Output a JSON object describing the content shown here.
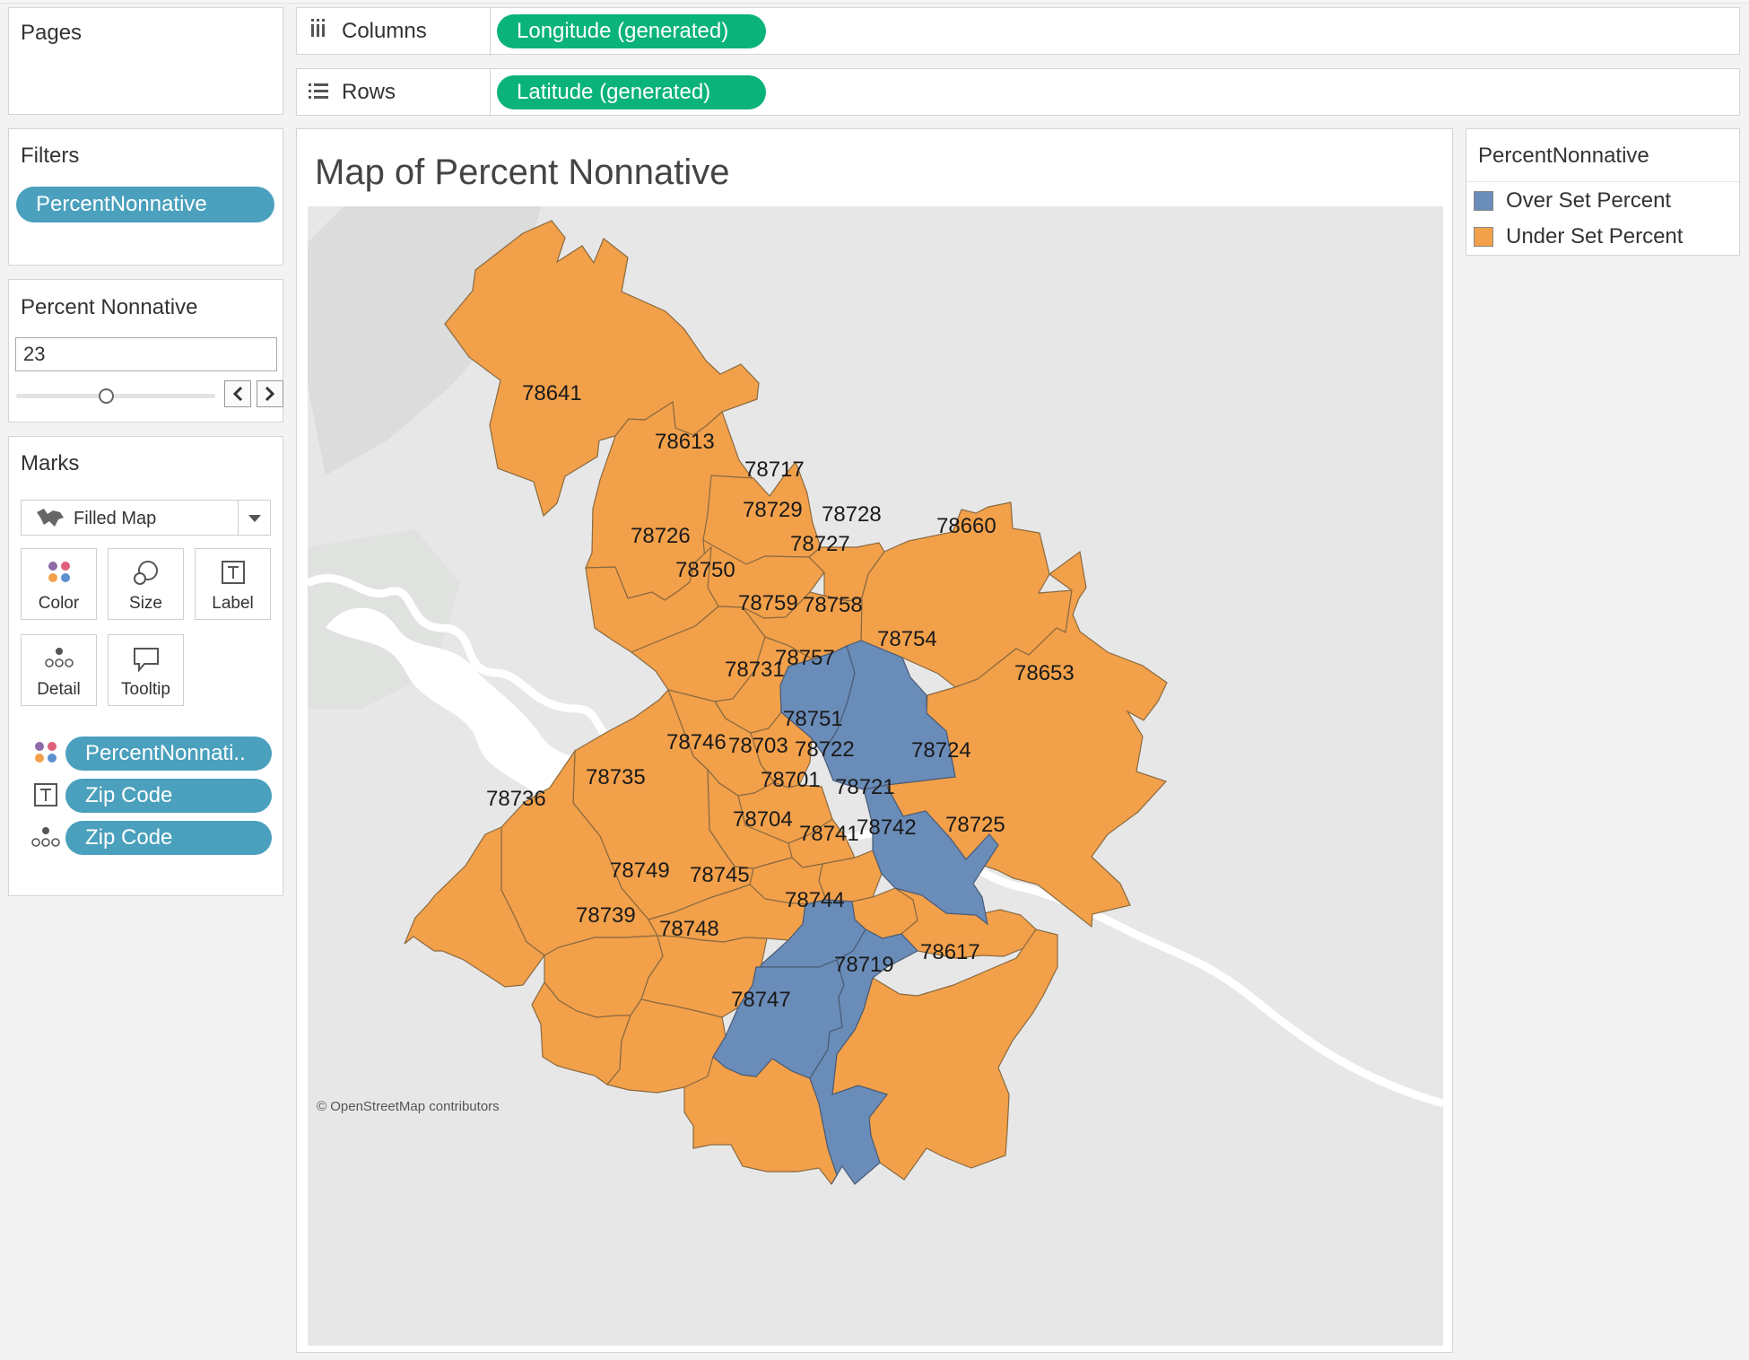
{
  "pages": {
    "title": "Pages"
  },
  "columns_shelf": {
    "label": "Columns",
    "pill": "Longitude (generated)"
  },
  "rows_shelf": {
    "label": "Rows",
    "pill": "Latitude (generated)"
  },
  "filters": {
    "title": "Filters",
    "pill": "PercentNonnative"
  },
  "parameter": {
    "title": "Percent Nonnative",
    "value": "23",
    "slider_fraction": 0.45
  },
  "marks": {
    "title": "Marks",
    "type": "Filled Map",
    "buttons": {
      "color": "Color",
      "size": "Size",
      "label": "Label",
      "detail": "Detail",
      "tooltip": "Tooltip"
    },
    "fields": [
      "PercentNonnati..",
      "Zip Code",
      "Zip Code"
    ]
  },
  "view": {
    "title": "Map of Percent Nonnative",
    "attribution": "© OpenStreetMap contributors",
    "colors": {
      "over": "#6a8cb8",
      "under": "#f2a04a"
    }
  },
  "legend": {
    "title": "PercentNonnative",
    "items": [
      {
        "label": "Over Set Percent",
        "color": "#6a8cb8"
      },
      {
        "label": "Under Set Percent",
        "color": "#f2a04a"
      }
    ]
  },
  "zip_labels": [
    "78641",
    "78613",
    "78717",
    "78729",
    "78728",
    "78660",
    "78726",
    "78727",
    "78750",
    "78759",
    "78758",
    "78754",
    "78653",
    "78757",
    "78731",
    "78751",
    "78724",
    "78746",
    "78703",
    "78722",
    "78735",
    "78701",
    "78721",
    "78736",
    "78704",
    "78741",
    "78742",
    "78725",
    "78749",
    "78745",
    "78744",
    "78739",
    "78748",
    "78719",
    "78617",
    "78747"
  ],
  "over_set": [
    "78758",
    "78754",
    "78724",
    "78741",
    "78744",
    "78719"
  ]
}
